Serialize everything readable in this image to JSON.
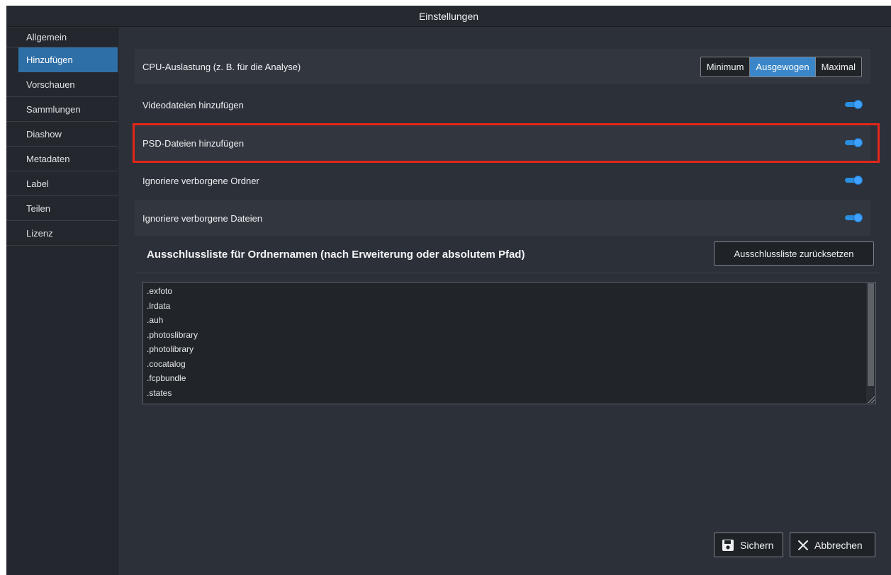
{
  "window": {
    "title": "Einstellungen"
  },
  "sidebar": {
    "items": [
      {
        "label": "Allgemein",
        "active": false
      },
      {
        "label": "Hinzufügen",
        "active": true
      },
      {
        "label": "Vorschauen",
        "active": false
      },
      {
        "label": "Sammlungen",
        "active": false
      },
      {
        "label": "Diashow",
        "active": false
      },
      {
        "label": "Metadaten",
        "active": false
      },
      {
        "label": "Label",
        "active": false
      },
      {
        "label": "Teilen",
        "active": false
      },
      {
        "label": "Lizenz",
        "active": false
      }
    ]
  },
  "settings": {
    "cpu": {
      "label": "CPU-Auslastung (z. B. für die Analyse)",
      "options": [
        "Minimum",
        "Ausgewogen",
        "Maximal"
      ],
      "selected": "Ausgewogen"
    },
    "toggles": [
      {
        "label": "Videodateien hinzufügen",
        "on": true
      },
      {
        "label": "PSD-Dateien hinzufügen",
        "on": true
      },
      {
        "label": "Ignoriere verborgene Ordner",
        "on": true
      },
      {
        "label": "Ignoriere verborgene Dateien",
        "on": true
      }
    ]
  },
  "exclusion": {
    "title": "Ausschlussliste für Ordnernamen (nach Erweiterung oder absolutem Pfad)",
    "reset_label": "Ausschlussliste zurücksetzen",
    "entries": [
      ".exfoto",
      ".lrdata",
      ".auh",
      ".photoslibrary",
      ".photolibrary",
      ".cocatalog",
      ".fcpbundle",
      ".states"
    ]
  },
  "footer": {
    "save_label": "Sichern",
    "cancel_label": "Abbrechen",
    "save_icon": "floppy-disk-icon",
    "cancel_icon": "close-icon"
  },
  "colors": {
    "accent": "#3a86c8",
    "toggle_on": "#3ea0ff",
    "highlight_border": "#e3261b",
    "background": "#2c3038"
  }
}
